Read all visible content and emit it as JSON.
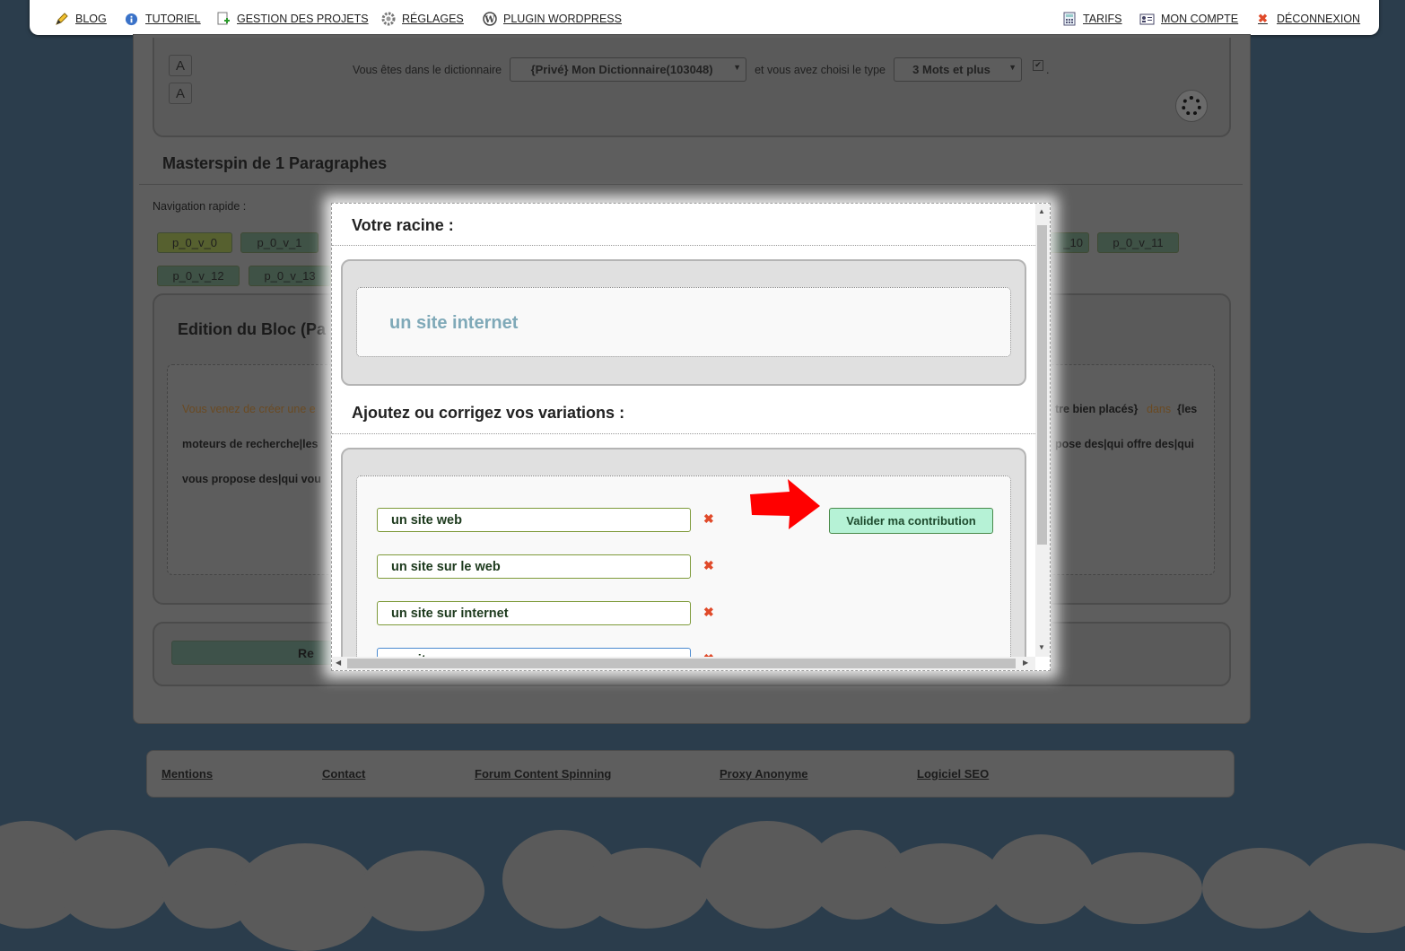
{
  "nav": {
    "blog": "BLOG",
    "tutoriel": "TUTORIEL",
    "gestion": "GESTION DES PROJETS",
    "reglages": "RÉGLAGES",
    "plugin": "PLUGIN WORDPRESS",
    "tarifs": "TARIFS",
    "compte": "MON COMPTE",
    "deconnexion": "DÉCONNEXION"
  },
  "toolbar": {
    "dict_prefix": "Vous êtes dans le dictionnaire",
    "dict_value": "{Privé} Mon Dictionnaire(103048)",
    "type_prefix": "et vous avez choisi le type",
    "type_value": "3 Mots et plus",
    "dot": "."
  },
  "section": {
    "title": "Masterspin de 1 Paragraphes",
    "nav_label": "Navigation rapide :",
    "chips": [
      "p_0_v_0",
      "p_0_v_1",
      "_10",
      "p_0_v_11",
      "p_0_v_12",
      "p_0_v_13"
    ],
    "edition_title": "Edition du Bloc (Pa",
    "text_line1_start": "Vous venez de créer une e",
    "text_line1_end_bold": "tre bien placés}",
    "text_line1_end_orange": "dans",
    "text_line1_end_tail": "{les",
    "text_line2_start": "moteurs de recherche|les",
    "text_line2_end": "pose des|qui offre des|qui",
    "text_line3_start": "vous propose des|qui vou",
    "bottom_button": "Re"
  },
  "modal": {
    "root_title": "Votre racine :",
    "root_value": "un site internet",
    "variations_title": "Ajoutez ou corrigez vos variations :",
    "variations": [
      "un site web",
      "un site sur le web",
      "un site sur internet",
      "un site"
    ],
    "submit": "Valider ma contribution",
    "delete_glyph": "✖"
  },
  "footer": {
    "mentions": "Mentions",
    "contact": "Contact",
    "forum": "Forum Content Spinning",
    "proxy": "Proxy Anonyme",
    "logiciel": "Logiciel SEO"
  },
  "icons": {
    "blog": "pencil-icon",
    "tutoriel": "info-icon",
    "gestion": "add-document-icon",
    "reglages": "gear-icon",
    "plugin": "wordpress-icon",
    "tarifs": "calculator-icon",
    "compte": "id-card-icon",
    "deconnexion": "close-icon"
  },
  "colors": {
    "page_bg": "#2b3d4c",
    "accent_green": "#b6f2d6",
    "root_text": "#7fa9b8",
    "arrow_red": "#ff0000"
  }
}
